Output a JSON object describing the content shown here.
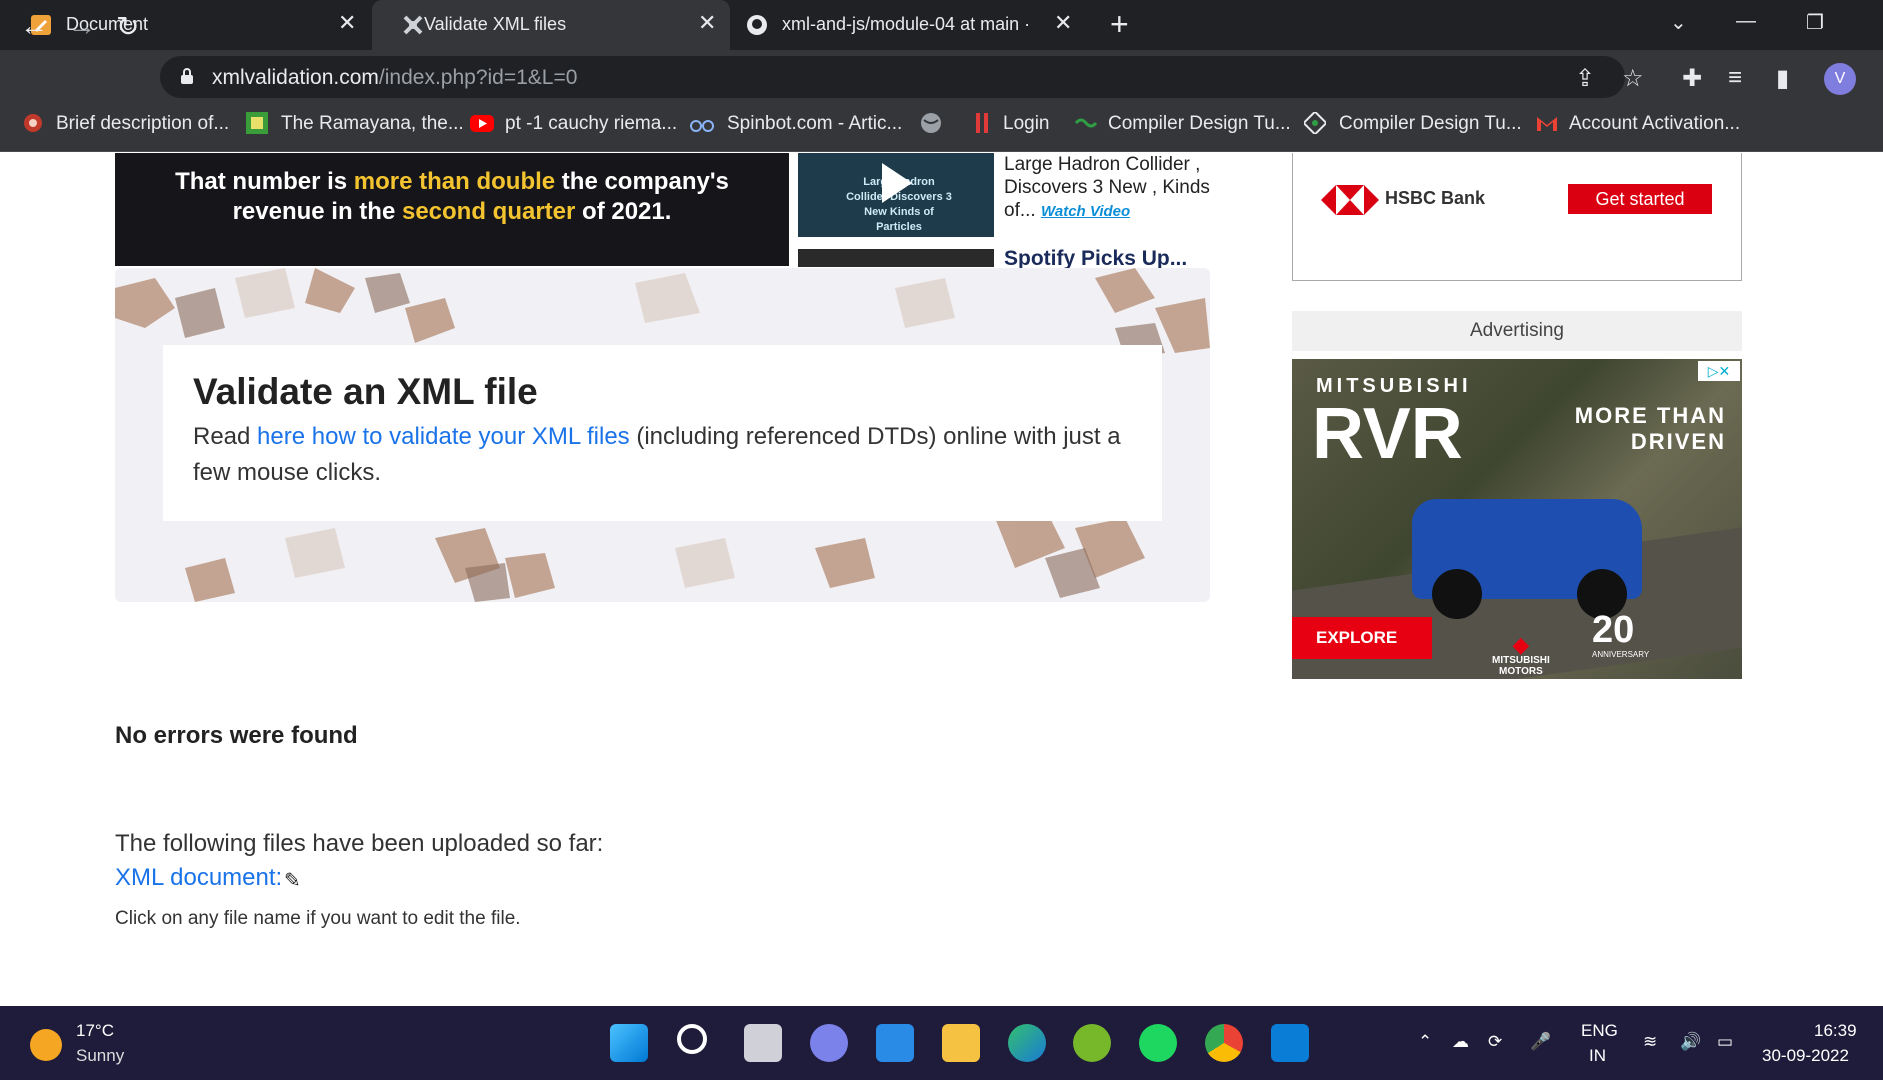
{
  "tabs": [
    {
      "title": "Document",
      "icon": "document-icon"
    },
    {
      "title": "Validate XML files",
      "icon": "xml-validation-icon"
    },
    {
      "title": "xml-and-js/module-04 at main ·",
      "icon": "github-icon"
    }
  ],
  "window": {
    "close": "✕",
    "new_tab": "+",
    "chevron": "⌄",
    "minimize": "—",
    "restore": "❐"
  },
  "address": {
    "host": "xmlvalidation.com",
    "path": "/index.php?id=1&L=0"
  },
  "avatar_letter": "V",
  "bookmarks": [
    {
      "label": "Brief description of...",
      "icon": "gear-flower-icon"
    },
    {
      "label": "The Ramayana, the...",
      "icon": "ramayana-icon"
    },
    {
      "label": "pt -1 cauchy riema...",
      "icon": "youtube-icon"
    },
    {
      "label": "Spinbot.com - Artic...",
      "icon": "spinbot-icon"
    },
    {
      "label": "",
      "icon": "globe-icon"
    },
    {
      "label": "Login",
      "icon": "login-icon"
    },
    {
      "label": "Compiler Design Tu...",
      "icon": "compiler-icon"
    },
    {
      "label": "Compiler Design Tu...",
      "icon": "compiler-icon-2"
    },
    {
      "label": "Account Activation...",
      "icon": "gmail-icon"
    }
  ],
  "news": {
    "headline_a": "That number is ",
    "headline_b": "more than double",
    "headline_c": " the company's",
    "headline_d": "revenue in the ",
    "headline_e": "second quarter",
    "headline_f": " of 2021.",
    "video_caption": "Large Hadron Collider Discovers 3 New Kinds of Particles",
    "video_title": "Large Hadron Collider , Discovers 3 New , Kinds of...",
    "video_link": "Watch Video",
    "video2_title": "Spotify Picks Up..."
  },
  "hero": {
    "title": "Validate an XML file",
    "text_before": "Read ",
    "link": "here how to validate your XML files",
    "text_after": " (including referenced DTDs) online with just a few mouse clicks."
  },
  "result": "No errors were found",
  "uploaded_label": "The following files have been uploaded so far:",
  "xml_document": "XML document:",
  "hint": "Click on any file name if you want to edit the file.",
  "ads": {
    "hsbc_name": "HSBC Bank",
    "hsbc_button": "Get started",
    "label": "Advertising",
    "brand": "MITSUBISHI",
    "model": "RVR",
    "tagline_1": "MORE THAN",
    "tagline_2": "DRIVEN",
    "explore": "EXPLORE",
    "maker_1": "MITSUBISHI",
    "maker_2": "MOTORS",
    "anniversary": "20",
    "anniversary_text": "ANNIVERSARY"
  },
  "taskbar": {
    "temp": "17°C",
    "weather": "Sunny",
    "lang_1": "ENG",
    "lang_2": "IN",
    "time": "16:39",
    "date": "30-09-2022"
  }
}
